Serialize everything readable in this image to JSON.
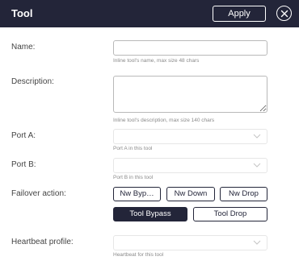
{
  "header": {
    "title": "Tool",
    "apply_label": "Apply",
    "close_icon": "close-circle-icon"
  },
  "fields": {
    "name": {
      "label": "Name:",
      "value": "",
      "hint": "Inline tool's name, max size 48 chars"
    },
    "description": {
      "label": "Description:",
      "value": "",
      "hint": "Inline tool's description, max size 140 chars"
    },
    "port_a": {
      "label": "Port A:",
      "value": "",
      "hint": "Port A in this tool"
    },
    "port_b": {
      "label": "Port B:",
      "value": "",
      "hint": "Port B in this tool"
    },
    "failover": {
      "label": "Failover action:",
      "options_row1": [
        "Nw Byp…",
        "Nw Down",
        "Nw Drop"
      ],
      "options_row2": [
        "Tool Bypass",
        "Tool Drop"
      ],
      "selected": "Tool Bypass"
    },
    "heartbeat": {
      "label": "Heartbeat profile:",
      "value": "",
      "hint": "Heartbeat for this tool"
    }
  },
  "colors": {
    "header_bg": "#232539",
    "border": "#b9b9b9",
    "hint": "#8a8a8a"
  }
}
